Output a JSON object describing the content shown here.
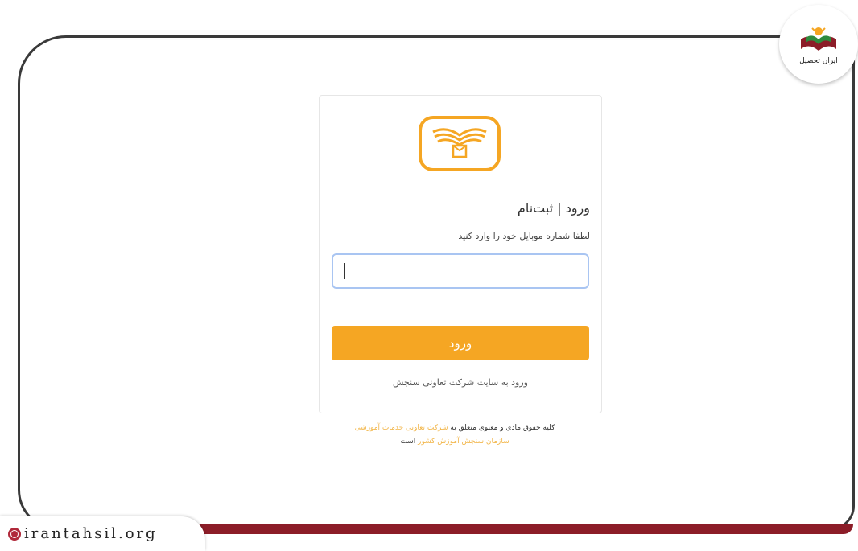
{
  "brand": {
    "badge_text": "ایران تحصیل",
    "watermark": "irantahsil.org"
  },
  "login": {
    "title": "ورود | ثبت‌نام",
    "subtitle": "لطفا شماره موبایل خود را وارد کنید",
    "phone_value": "",
    "button_label": "ورود",
    "site_link": "ورود به سایت شرکت تعاونی سنجش"
  },
  "footer": {
    "prefix": "کلیه حقوق مادی و معنوی متعلق به",
    "link1": "شرکت تعاونی خدمات آموزشی",
    "link2": "سازمان سنجش آموزش کشور",
    "suffix": "است"
  },
  "colors": {
    "accent": "#f5a623",
    "brand_red": "#8c1d28",
    "input_focus": "#a9c5f2"
  }
}
